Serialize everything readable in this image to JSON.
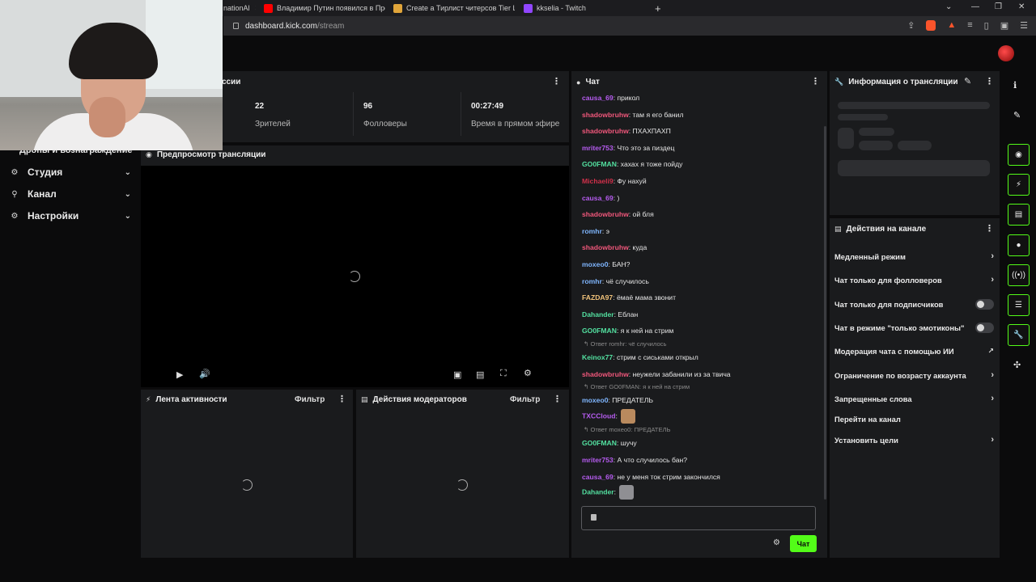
{
  "browser": {
    "tabs": [
      {
        "label": "nationAl",
        "fav_color": "#d04f4f"
      },
      {
        "label": "Владимир Путин появился в Просто",
        "fav_color": "#ff0000"
      },
      {
        "label": "Create a Тирлист читерсов Tier List -",
        "fav_color": "#e0a53a"
      },
      {
        "label": "kkselia - Twitch",
        "fav_color": "#9146ff"
      }
    ],
    "new_tab": "+",
    "url_host": "dashboard.kick.com",
    "url_path": "/stream"
  },
  "nav": {
    "cut_label": "Дропы и вознаграждение",
    "items": [
      {
        "label": "Студия",
        "icon": "⚙"
      },
      {
        "label": "Канал",
        "icon": "⚲"
      },
      {
        "label": "Настройки",
        "icon": "⚙"
      }
    ]
  },
  "session": {
    "title_cut": "ссии",
    "viewers": "22",
    "viewers_label": "Зрителей",
    "followers": "96",
    "followers_label": "Фолловеры",
    "uptime": "00:27:49",
    "uptime_label": "Время в прямом эфире"
  },
  "preview": {
    "title": "Предпросмотр трансляции"
  },
  "activity": {
    "title": "Лента активности",
    "filter": "Фильтр"
  },
  "modactions": {
    "title": "Действия модераторов",
    "filter": "Фильтр"
  },
  "chat": {
    "title": "Чат",
    "send_label": "Чат",
    "messages": [
      {
        "user": "causa_69",
        "color": "#b65cf0",
        "text": ": прикол"
      },
      {
        "user": "shadowbruhw",
        "color": "#f0577b",
        "text": ": там я его банил"
      },
      {
        "user": "shadowbruhw",
        "color": "#f0577b",
        "text": ": ПХАХПАХП"
      },
      {
        "user": "mriter753",
        "color": "#b65cf0",
        "text": ": Что это за пиздец"
      },
      {
        "user": "GO0FMAN",
        "color": "#53e0a0",
        "text": ": хахах я тоже пойду"
      },
      {
        "user": "Michaeli9",
        "color": "#d0304a",
        "text": ": Фу нахуй"
      },
      {
        "user": "causa_69",
        "color": "#b65cf0",
        "text": ": )"
      },
      {
        "user": "shadowbruhw",
        "color": "#f0577b",
        "text": ": ой бля"
      },
      {
        "user": "romhr",
        "color": "#7fb6ff",
        "text": ": э"
      },
      {
        "user": "shadowbruhw",
        "color": "#f0577b",
        "text": ": куда"
      },
      {
        "user": "moxeo0",
        "color": "#7fb6ff",
        "text": ": БАН?"
      },
      {
        "user": "romhr",
        "color": "#7fb6ff",
        "text": ": чё случилось"
      },
      {
        "user": "FAZDA97",
        "color": "#f0c27a",
        "text": ": ёмаё мама звонит"
      },
      {
        "user": "Dahander",
        "color": "#53e0a0",
        "text": ": Еблан"
      },
      {
        "user": "GO0FMAN",
        "color": "#53e0a0",
        "text": ": я к ней на стрим"
      },
      {
        "user": "Keinox77",
        "color": "#53e0a0",
        "text": ": стрим с сиськами открыл",
        "reply": "Ответ romhr: чё случилось"
      },
      {
        "user": "shadowbruhw",
        "color": "#f0577b",
        "text": ": неужели забанили из за твича"
      },
      {
        "user": "moxeo0",
        "color": "#7fb6ff",
        "text": ": ПРЕДАТЕЛЬ",
        "reply": "Ответ GO0FMAN: я к ней на стрим"
      },
      {
        "user": "TXCCloud",
        "color": "#b65cf0",
        "text": ":",
        "emote": "#b98a5e"
      },
      {
        "user": "GO0FMAN",
        "color": "#53e0a0",
        "text": ": шучу",
        "reply": "Ответ moxeo0: ПРЕДАТЕЛЬ"
      },
      {
        "user": "mriter753",
        "color": "#b65cf0",
        "text": ": А что случилось бан?"
      },
      {
        "user": "causa_69",
        "color": "#b65cf0",
        "text": ": не у меня ток стрим закончился"
      },
      {
        "user": "Dahander",
        "color": "#53e0a0",
        "text": ":",
        "emote": "#8f8f93"
      }
    ]
  },
  "info": {
    "title": "Информация о трансляции"
  },
  "channel_actions": {
    "title": "Действия на канале",
    "items": [
      {
        "label": "Медленный режим",
        "kind": "chevron"
      },
      {
        "label": "Чат только для фолловеров",
        "kind": "chevron"
      },
      {
        "label": "Чат только для подписчиков",
        "kind": "toggle"
      },
      {
        "label": "Чат в режиме \"только эмотиконы\"",
        "kind": "toggle"
      },
      {
        "label": "Модерация чата с помощью ИИ",
        "kind": "external"
      },
      {
        "label": "Ограничение по возрасту аккаунта",
        "kind": "chevron"
      },
      {
        "label": "Запрещенные слова",
        "kind": "chevron"
      },
      {
        "label": "Перейти на канал",
        "kind": "none"
      },
      {
        "label": "Установить цели",
        "kind": "chevron"
      }
    ]
  },
  "colors": {
    "accent": "#53fc18",
    "panel": "#1a1b1d",
    "background": "#0b0b0c"
  }
}
